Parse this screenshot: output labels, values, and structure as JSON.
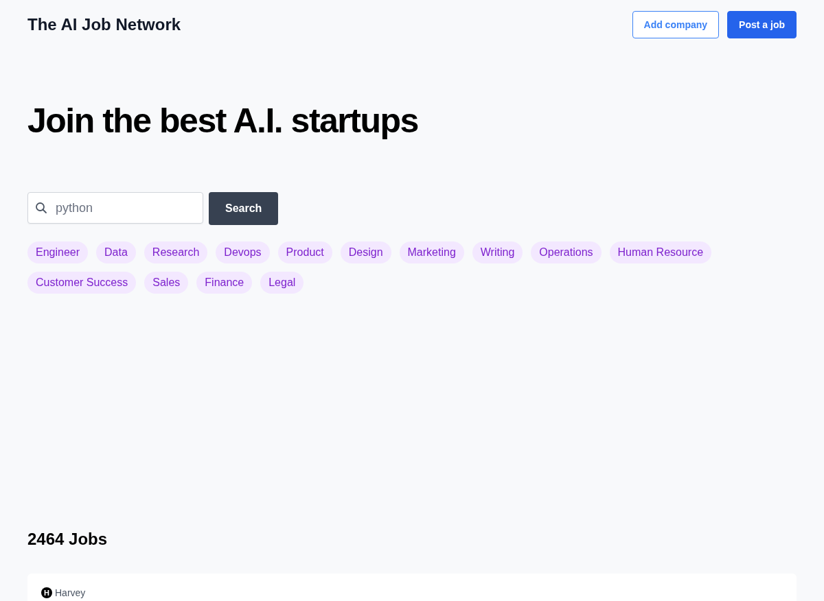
{
  "header": {
    "site_title": "The AI Job Network",
    "buttons": [
      {
        "label": "Add company",
        "kind": "outline"
      },
      {
        "label": "Post a job",
        "kind": "primary"
      }
    ]
  },
  "hero": {
    "headline": "Join the best A.I. startups"
  },
  "search": {
    "placeholder": "python",
    "button": "Search"
  },
  "categories": [
    "Engineer",
    "Data",
    "Research",
    "Devops",
    "Product",
    "Design",
    "Marketing",
    "Writing",
    "Operations",
    "Human Resource",
    "Customer Success",
    "Sales",
    "Finance",
    "Legal"
  ],
  "jobs": {
    "count_label": "2464 Jobs",
    "listings": [
      {
        "company": "Harvey",
        "logo_letter": "H"
      }
    ]
  }
}
